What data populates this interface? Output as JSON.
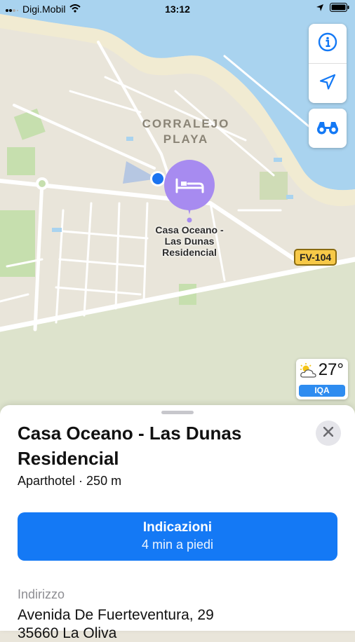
{
  "status_bar": {
    "carrier": "Digi.Mobil",
    "time": "13:12"
  },
  "map": {
    "district_label_line1": "CORRALEJO",
    "district_label_line2": "PLAYA",
    "poi_label_line1": "Casa Oceano -",
    "poi_label_line2": "Las Dunas",
    "poi_label_line3": "Residencial",
    "road_shield": "FV-104",
    "controls": [
      "info-icon",
      "location-arrow-icon",
      "binoculars-icon"
    ],
    "water_color": "#a9d3ef",
    "pin_color": "#a78bf0"
  },
  "weather": {
    "temperature": "27°",
    "aqi_label": "IQA"
  },
  "place_card": {
    "title": "Casa Oceano - Las Dunas Residencial",
    "subtitle": "Aparthotel · 250 m",
    "directions_label": "Indicazioni",
    "directions_eta": "4 min a piedi",
    "address_label": "Indirizzo",
    "address_line1": "Avenida De Fuerteventura, 29",
    "address_line2": "35660 La Oliva",
    "accent": "#1479f5"
  }
}
